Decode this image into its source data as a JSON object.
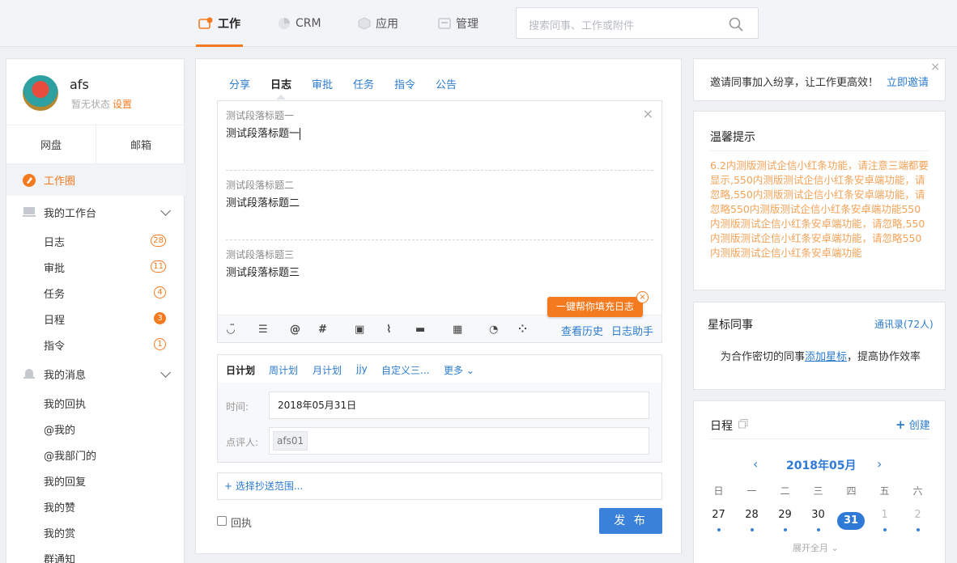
{
  "topnav": {
    "items": [
      {
        "label": "工作",
        "icon": "work-icon",
        "active": true
      },
      {
        "label": "CRM",
        "icon": "crm-icon"
      },
      {
        "label": "应用",
        "icon": "apps-icon"
      },
      {
        "label": "管理",
        "icon": "manage-icon"
      }
    ],
    "search_placeholder": "搜索同事、工作或附件"
  },
  "profile": {
    "name": "afs",
    "status": "暂无状态",
    "settings": "设置"
  },
  "sidebar": {
    "quick": [
      "网盘",
      "邮箱"
    ],
    "work_circle": "工作圈",
    "workbench": "我的工作台",
    "work_items": [
      {
        "label": "日志",
        "badge": "28",
        "solid": false
      },
      {
        "label": "审批",
        "badge": "11",
        "solid": false
      },
      {
        "label": "任务",
        "badge": "4",
        "solid": false
      },
      {
        "label": "日程",
        "badge": "3",
        "solid": true
      },
      {
        "label": "指令",
        "badge": "1",
        "solid": false
      }
    ],
    "messages": "我的消息",
    "message_items": [
      "我的回执",
      "@我的",
      "@我部门的",
      "我的回复",
      "我的赞",
      "我的赏",
      "群通知"
    ]
  },
  "compose": {
    "tabs": [
      "分享",
      "日志",
      "审批",
      "任务",
      "指令",
      "公告"
    ],
    "active_tab": "日志",
    "sections": [
      {
        "label": "测试段落标题一",
        "text": "测试段落标题一"
      },
      {
        "label": "测试段落标题二",
        "text": "测试段落标题二"
      },
      {
        "label": "测试段落标题三",
        "text": "测试段落标题三"
      }
    ],
    "helper_tip": "一键帮你填充日志",
    "toolbar_links": {
      "history": "查看历史",
      "assistant": "日志助手"
    },
    "plan_tabs": [
      "日计划",
      "周计划",
      "月计划",
      "jjy",
      "自定义三...",
      "更多"
    ],
    "time_label": "时间:",
    "time_value": "2018年05月31日",
    "reviewer_label": "点评人:",
    "reviewer_value": "afs01",
    "cc": "+ 选择抄送范围...",
    "receipt": "回执",
    "publish": "发 布"
  },
  "invite": {
    "text": "邀请同事加入纷享，让工作更高效！",
    "link": "立即邀请"
  },
  "tips": {
    "title": "温馨提示",
    "body": "6.2内测版测试企信小红条功能，请注意三端都要显示,550内测版测试企信小红条安卓端功能，请忽略,550内测版测试企信小红条安卓端功能，请忽略550内测版测试企信小红条安卓端功能550内测版测试企信小红条安卓端功能，请忽略,550内测版测试企信小红条安卓端功能，请忽略550内测版测试企信小红条安卓端功能"
  },
  "starred": {
    "title": "星标同事",
    "contacts": "通讯录(72人)",
    "hint_pre": "为合作密切的同事",
    "hint_link": "添加星标",
    "hint_post": "，提高协作效率"
  },
  "calendar": {
    "title": "日程",
    "create": "创建",
    "month": "2018年05月",
    "weekdays": [
      "日",
      "一",
      "二",
      "三",
      "四",
      "五",
      "六"
    ],
    "days": [
      "27",
      "28",
      "29",
      "30",
      "31",
      "1",
      "2"
    ],
    "expand": "展开全月"
  },
  "colors": {
    "accent": "#f47a1f",
    "link": "#2b7bce",
    "primary": "#3a82d9"
  }
}
